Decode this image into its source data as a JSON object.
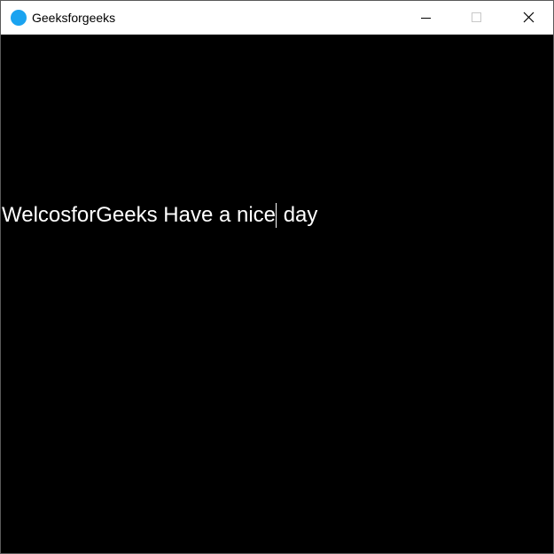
{
  "window": {
    "title": "Geeksforgeeks",
    "icon": "app-circle-icon",
    "accent_color": "#1aa3f0",
    "controls": [
      "minimize-icon",
      "maximize-icon",
      "close-icon"
    ]
  },
  "canvas": {
    "background": "#000000",
    "text_before_caret": "WelcosforGeeks Have a nice",
    "text_after_caret": " day",
    "text_color": "#ffffff"
  }
}
